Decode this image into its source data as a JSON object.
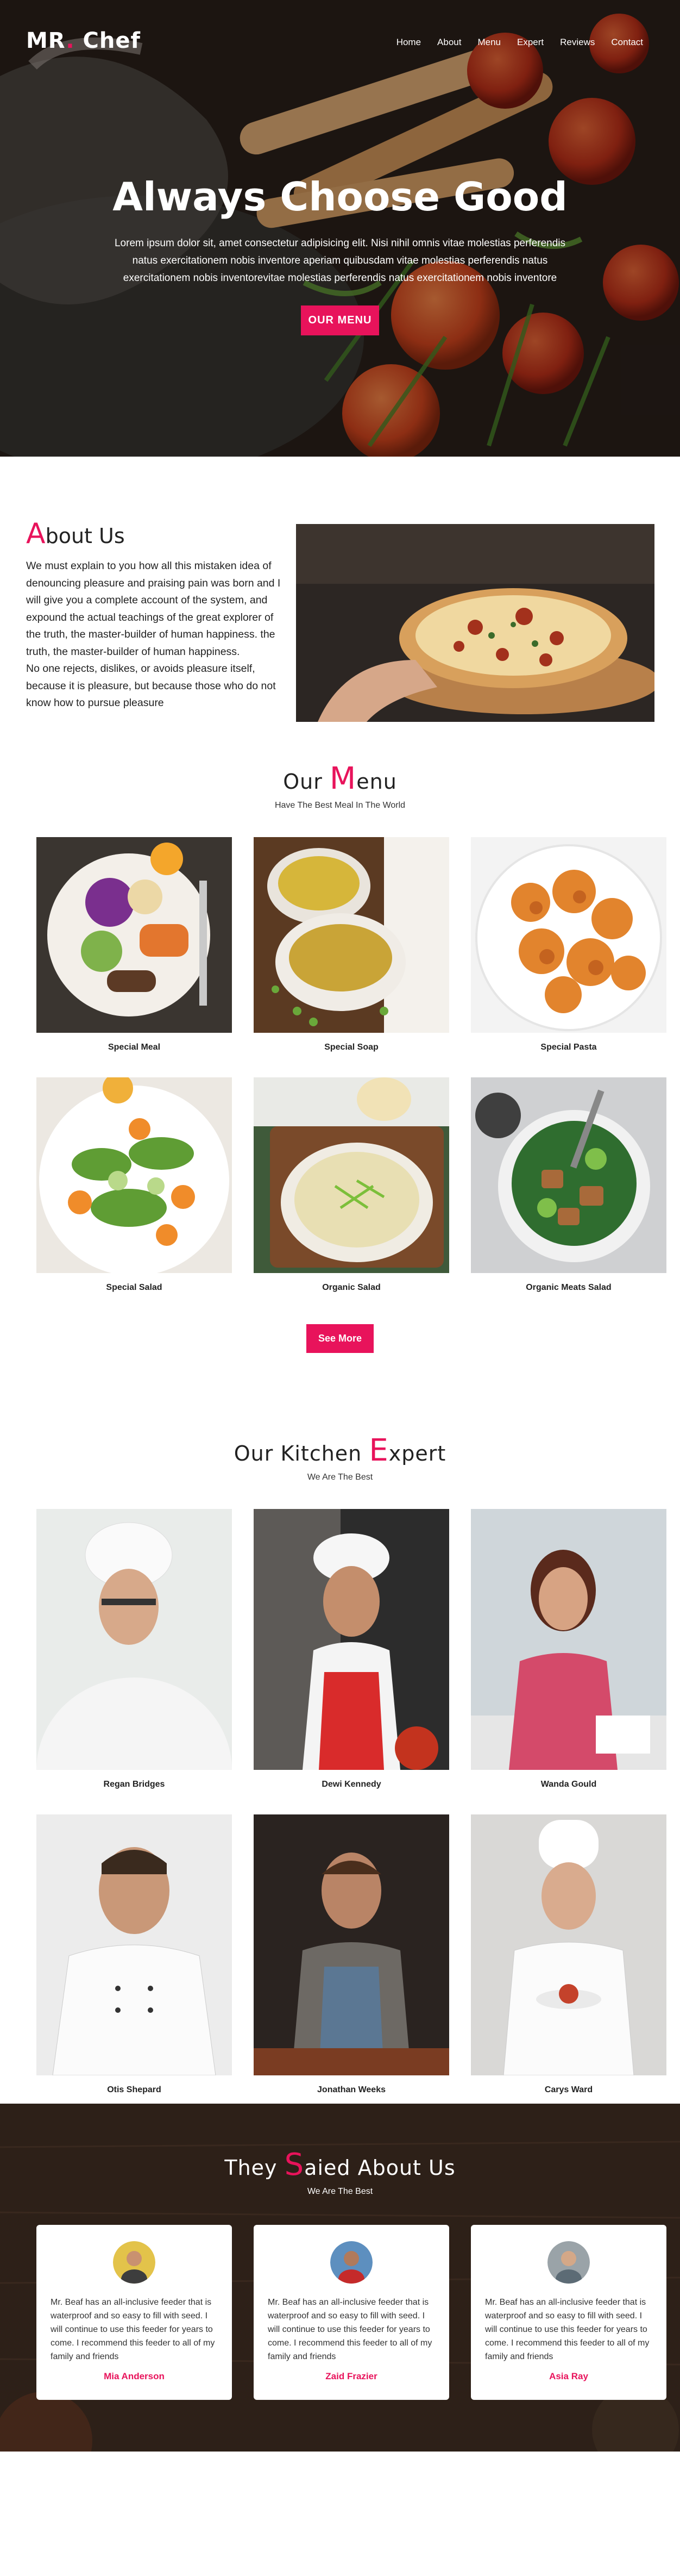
{
  "nav": {
    "logo_left": "MR",
    "logo_dot": ".",
    "logo_right": "Chef",
    "items": [
      "Home",
      "About",
      "Menu",
      "Expert",
      "Reviews",
      "Contact"
    ]
  },
  "hero": {
    "title": "Always Choose Good",
    "text": "Lorem ipsum dolor sit, amet consectetur adipisicing elit. Nisi nihil omnis vitae molestias perferendis natus exercitationem nobis inventore aperiam quibusdam vitae molestias perferendis natus exercitationem nobis inventorevitae molestias perferendis natus exercitationem nobis inventore",
    "button": "OUR MENU"
  },
  "about": {
    "title_first": "A",
    "title_rest": "bout Us",
    "body": "We must explain to you how all this mistaken idea of denouncing pleasure and praising pain was born and I will give you a complete account of the system, and expound the actual teachings of the great explorer of the truth, the master-builder of human happiness. the truth, the master-builder of human happiness.\nNo one rejects, dislikes, or avoids pleasure itself, because it is pleasure, but because those who do not know how to pursue pleasure"
  },
  "menu": {
    "title_pre": "Our ",
    "title_big": "M",
    "title_rest": "enu",
    "subtitle": "Have The Best Meal In The World",
    "items": [
      "Special Meal",
      "Special Soap",
      "Special Pasta",
      "Special Salad",
      "Organic Salad",
      "Organic Meats Salad"
    ],
    "button": "See More"
  },
  "experts": {
    "title_pre": "Our Kitchen ",
    "title_big": "E",
    "title_rest": "xpert",
    "subtitle": "We Are The Best",
    "people": [
      "Regan Bridges",
      "Dewi Kennedy",
      "Wanda Gould",
      "Otis Shepard",
      "Jonathan Weeks",
      "Carys Ward"
    ]
  },
  "reviews": {
    "title_pre": "They ",
    "title_big": "S",
    "title_rest": "aied About Us",
    "subtitle": "We Are The Best",
    "items": [
      {
        "text": "Mr. Beaf has an all-inclusive feeder that is waterproof and so easy to fill with seed. I will continue to use this feeder for years to come. I recommend this feeder to all of my family and friends",
        "name": "Mia Anderson"
      },
      {
        "text": "Mr. Beaf has an all-inclusive feeder that is waterproof and so easy to fill with seed. I will continue to use this feeder for years to come. I recommend this feeder to all of my family and friends",
        "name": "Zaid Frazier"
      },
      {
        "text": "Mr. Beaf has an all-inclusive feeder that is waterproof and so easy to fill with seed. I will continue to use this feeder for years to come. I recommend this feeder to all of my family and friends",
        "name": "Asia Ray"
      }
    ]
  },
  "colors": {
    "accent": "#e8135b"
  }
}
